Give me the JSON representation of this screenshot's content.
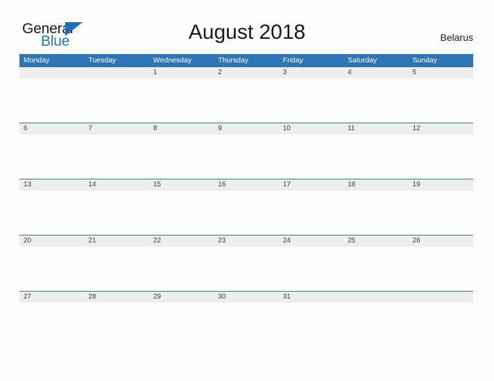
{
  "logo": {
    "primary_text": "General",
    "secondary_text": "Blue",
    "triangle_icon": "triangle-icon",
    "primary_color": "#1b1b1b",
    "secondary_color": "#1f77c2",
    "triangle_color": "#1f6fb5"
  },
  "header": {
    "title": "August 2018",
    "region": "Belarus"
  },
  "theme": {
    "header_blue": "#2e75b6",
    "band_gray": "#eeeeee",
    "page_background": "#fdfdfd",
    "date_text": "#3b3b3b"
  },
  "calendar": {
    "month": "August",
    "year": "2018",
    "weekday_start": "Monday",
    "weekdays": [
      "Monday",
      "Tuesday",
      "Wednesday",
      "Thursday",
      "Friday",
      "Saturday",
      "Sunday"
    ],
    "weeks": [
      [
        {
          "day": ""
        },
        {
          "day": ""
        },
        {
          "day": "1"
        },
        {
          "day": "2"
        },
        {
          "day": "3"
        },
        {
          "day": "4"
        },
        {
          "day": "5"
        }
      ],
      [
        {
          "day": "6"
        },
        {
          "day": "7"
        },
        {
          "day": "8"
        },
        {
          "day": "9"
        },
        {
          "day": "10"
        },
        {
          "day": "11"
        },
        {
          "day": "12"
        }
      ],
      [
        {
          "day": "13"
        },
        {
          "day": "14"
        },
        {
          "day": "15"
        },
        {
          "day": "16"
        },
        {
          "day": "17"
        },
        {
          "day": "18"
        },
        {
          "day": "19"
        }
      ],
      [
        {
          "day": "20"
        },
        {
          "day": "21"
        },
        {
          "day": "22"
        },
        {
          "day": "23"
        },
        {
          "day": "24"
        },
        {
          "day": "25"
        },
        {
          "day": "26"
        }
      ],
      [
        {
          "day": "27"
        },
        {
          "day": "28"
        },
        {
          "day": "29"
        },
        {
          "day": "30"
        },
        {
          "day": "31"
        },
        {
          "day": ""
        },
        {
          "day": ""
        }
      ]
    ]
  }
}
